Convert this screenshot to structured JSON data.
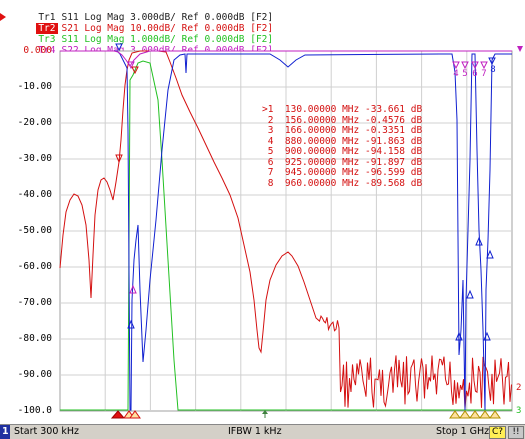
{
  "traces": [
    {
      "id": "Tr1",
      "rest": "S11 Log Mag 3.000dB/ Ref 0.000dB [F2]",
      "color": "#202020",
      "active": false
    },
    {
      "id": "Tr2",
      "rest": "S21 Log Mag 10.00dB/ Ref 0.000dB [F2]",
      "color": "#d41010",
      "active": true
    },
    {
      "id": "Tr3",
      "rest": "S11 Log Mag 1.000dB/ Ref 0.000dB [F2]",
      "color": "#22c022",
      "active": false
    },
    {
      "id": "Tr4",
      "rest": "S22 Log Mag 3.000dB/ Ref 0.000dB [F2]",
      "color": "#c020c0",
      "active": false
    }
  ],
  "y_axis_labels": [
    "0.000",
    "-10.00",
    "-20.00",
    "-30.00",
    "-40.00",
    "-50.00",
    "-60.00",
    "-70.00",
    "-80.00",
    "-90.00",
    "-100.0"
  ],
  "marker_table": [
    {
      "idx": ">1",
      "freq": "130.00000 MHz",
      "value": "-33.661 dB"
    },
    {
      "idx": "2",
      "freq": "156.00000 MHz",
      "value": "-0.4576 dB"
    },
    {
      "idx": "3",
      "freq": "166.00000 MHz",
      "value": "-0.3351 dB"
    },
    {
      "idx": "4",
      "freq": "880.00000 MHz",
      "value": "-91.863 dB"
    },
    {
      "idx": "5",
      "freq": "900.00000 MHz",
      "value": "-94.158 dB"
    },
    {
      "idx": "6",
      "freq": "925.00000 MHz",
      "value": "-91.897 dB"
    },
    {
      "idx": "7",
      "freq": "945.00000 MHz",
      "value": "-96.599 dB"
    },
    {
      "idx": "8",
      "freq": "960.00000 MHz",
      "value": "-89.568 dB"
    }
  ],
  "top_marker_numbers": [
    "4",
    "5",
    "6",
    "7",
    "8"
  ],
  "right_edge_labels": [
    "2",
    "3"
  ],
  "status_bar": {
    "channel": "1",
    "start": "Start 300 kHz",
    "ifbw": "IFBW 1 kHz",
    "stop": "Stop 1 GHz",
    "c_indicator": "C?",
    "ok_indicator": "!!"
  },
  "colors": {
    "tr1": "#202020",
    "tr2": "#d41010",
    "tr3": "#22c022",
    "tr4": "#c020c0",
    "blue": "#1020d0",
    "grid": "#c0c0c0",
    "active_badge": "#e01010",
    "warn": "#ffee55"
  }
}
